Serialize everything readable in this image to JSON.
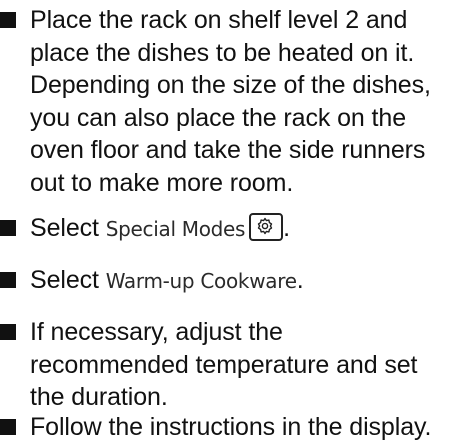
{
  "steps": [
    {
      "lines": [
        "Place the rack on shelf level 2 and",
        "place the dishes to be heated on it.",
        "Depending on the size of the dishes,",
        "you can also place the rack on the",
        "oven floor and take the side runners",
        "out to make more room."
      ]
    },
    {
      "prefix": "Select ",
      "ui_text": "Special Modes",
      "icon": "special-modes-gear-icon",
      "suffix": "."
    },
    {
      "prefix": "Select ",
      "ui_text": "Warm-up Cookware",
      "suffix": "."
    },
    {
      "lines": [
        "If necessary, adjust the",
        "recommended temperature and set",
        "the duration."
      ]
    },
    {
      "lines": [
        "Follow the instructions in the display."
      ]
    }
  ]
}
